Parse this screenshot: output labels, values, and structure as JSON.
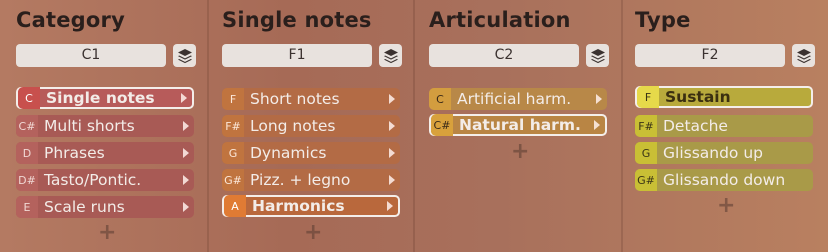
{
  "columns": [
    {
      "title": "Category",
      "key": "C1",
      "items": [
        {
          "key": "C",
          "label": "Single notes",
          "selected": true
        },
        {
          "key": "C#",
          "label": "Multi shorts",
          "selected": false
        },
        {
          "key": "D",
          "label": "Phrases",
          "selected": false
        },
        {
          "key": "D#",
          "label": "Tasto/Pontic.",
          "selected": false
        },
        {
          "key": "E",
          "label": "Scale runs",
          "selected": false
        }
      ]
    },
    {
      "title": "Single notes",
      "key": "F1",
      "items": [
        {
          "key": "F",
          "label": "Short notes",
          "selected": false
        },
        {
          "key": "F#",
          "label": "Long notes",
          "selected": false
        },
        {
          "key": "G",
          "label": "Dynamics",
          "selected": false
        },
        {
          "key": "G#",
          "label": "Pizz. + legno",
          "selected": false
        },
        {
          "key": "A",
          "label": "Harmonics",
          "selected": true
        }
      ]
    },
    {
      "title": "Articulation",
      "key": "C2",
      "items": [
        {
          "key": "C",
          "label": "Artificial harm.",
          "selected": false
        },
        {
          "key": "C#",
          "label": "Natural harm.",
          "selected": true
        }
      ]
    },
    {
      "title": "Type",
      "key": "F2",
      "items": [
        {
          "key": "F",
          "label": "Sustain",
          "selected": true
        },
        {
          "key": "F#",
          "label": "Detache",
          "selected": false
        },
        {
          "key": "G",
          "label": "Glissando up",
          "selected": false
        },
        {
          "key": "G#",
          "label": "Glissando down",
          "selected": false
        }
      ]
    }
  ],
  "plus_label": "+",
  "colors": {
    "category": "#a85a55",
    "single_notes": "#b36b45",
    "articulation": "#b88848",
    "type": "#a99a48",
    "selected_border": "#f4eeea"
  },
  "icons": {
    "layers": "layers-icon",
    "arrow": "chevron-right-icon",
    "add": "plus-icon"
  }
}
